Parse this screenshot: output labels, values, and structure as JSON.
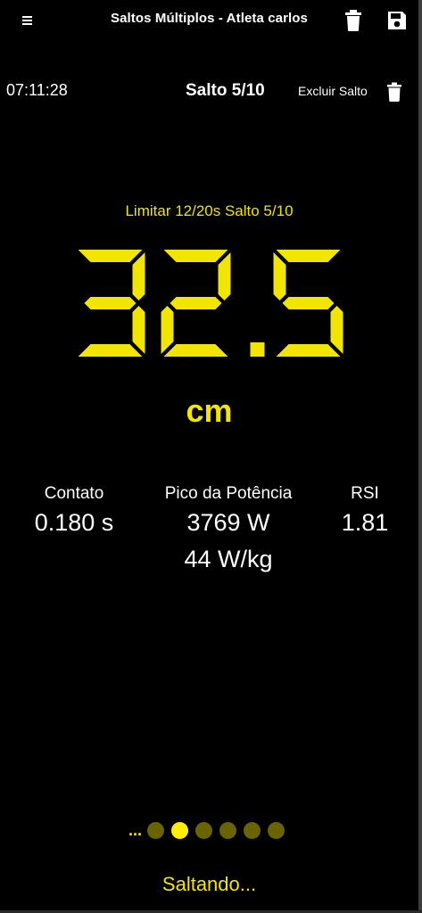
{
  "appbar": {
    "title": "Saltos Múltiplos - Atleta carlos",
    "menu_icon": "hamburger-menu-icon",
    "delete_icon": "trash-icon",
    "save_icon": "floppy-disk-icon"
  },
  "info": {
    "clock": "07:11:28",
    "jump_counter": "Salto 5/10",
    "delete_jump_label": "Excluir Salto"
  },
  "measurement": {
    "limit_label": "Limitar 12/20s Salto 5/10",
    "value": "32.5",
    "unit": "cm"
  },
  "stats": {
    "contact": {
      "label": "Contato",
      "value": "0.180 s"
    },
    "peak_power": {
      "label": "Pico da Potência",
      "value": "3769 W",
      "value_relative": "44 W/kg"
    },
    "rsi": {
      "label": "RSI",
      "value": "1.81"
    }
  },
  "pager": {
    "ellipsis": "...",
    "total_dots": 6,
    "active_index": 1
  },
  "status": "Saltando...",
  "colors": {
    "accent": "#f2e500",
    "dot_inactive": "#6a6400",
    "background": "#000000"
  }
}
